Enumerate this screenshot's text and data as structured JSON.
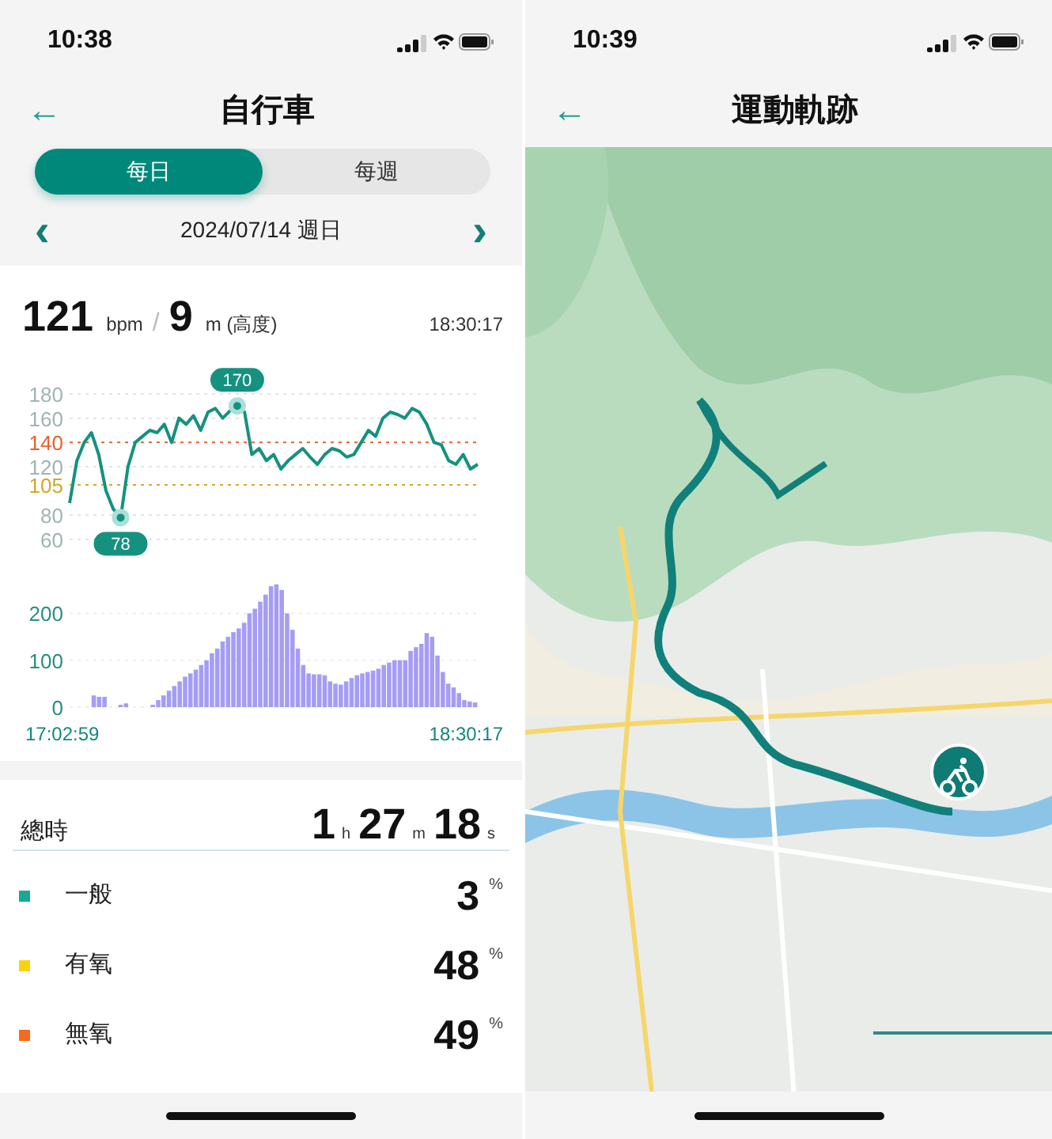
{
  "screens": [
    {
      "status_bar": {
        "time": "10:38"
      },
      "header": {
        "back": "←",
        "title": "自行車"
      },
      "tabs": [
        {
          "label": "每日",
          "selected": true
        },
        {
          "label": "每週",
          "selected": false
        }
      ],
      "date_nav": {
        "prev": "‹",
        "date": "2024/07/14 週日",
        "next": "›"
      },
      "reading": {
        "heart_rate": "121",
        "heart_unit": "bpm",
        "separator": "/",
        "altitude": "9",
        "altitude_unit": "m (高度)",
        "time": "18:30:17"
      },
      "heart_chart": {
        "chart_data": {
          "type": "line",
          "grid": true,
          "ylim": [
            60,
            180
          ],
          "yticks": [
            60,
            80,
            {
              "value": 105,
              "label": "105"
            },
            120,
            {
              "value": 140,
              "label": "140"
            },
            160,
            180
          ],
          "series": [
            {
              "color": "#14927f",
              "values": [
                90,
                125,
                140,
                148,
                130,
                100,
                85,
                78,
                120,
                140,
                145,
                150,
                148,
                155,
                140,
                160,
                155,
                162,
                150,
                165,
                168,
                160,
                166,
                170,
                165,
                130,
                135,
                125,
                130,
                118,
                125,
                130,
                135,
                128,
                122,
                130,
                135,
                133,
                128,
                130,
                140,
                150,
                145,
                160,
                165,
                163,
                160,
                168,
                165,
                155,
                140,
                138,
                125,
                122,
                130,
                118,
                122
              ]
            }
          ],
          "ref_lines": [
            {
              "axis": "y",
              "value": 140,
              "color": "#e8622c"
            },
            {
              "axis": "y",
              "value": 105,
              "color": "#d4a82a"
            }
          ],
          "annotations": [
            {
              "y": 78,
              "text": "78"
            },
            {
              "y": 170,
              "text": "170"
            }
          ]
        }
      },
      "power_chart": {
        "time_range": {
          "start": "17:02:59",
          "end": "18:30:17"
        },
        "chart_data": {
          "type": "bar",
          "grid": true,
          "ylim": [
            0,
            270
          ],
          "yticks": [
            0,
            100,
            200
          ],
          "series": [
            {
              "color": "#a59cf5",
              "values": [
                0,
                0,
                0,
                0,
                25,
                22,
                22,
                0,
                0,
                5,
                8,
                0,
                0,
                0,
                0,
                5,
                15,
                25,
                35,
                45,
                55,
                65,
                72,
                80,
                90,
                100,
                115,
                125,
                140,
                150,
                160,
                168,
                180,
                200,
                210,
                225,
                240,
                258,
                262,
                250,
                200,
                165,
                125,
                90,
                72,
                70,
                70,
                68,
                55,
                50,
                48,
                55,
                62,
                68,
                72,
                75,
                78,
                82,
                90,
                95,
                100,
                100,
                100,
                120,
                128,
                135,
                158,
                150,
                110,
                75,
                50,
                42,
                30,
                15,
                12,
                10
              ]
            }
          ]
        }
      },
      "total": {
        "label": "總時",
        "parts": [
          {
            "value": "1",
            "unit": "h"
          },
          {
            "value": "27",
            "unit": "m"
          },
          {
            "value": "18",
            "unit": "s"
          }
        ]
      },
      "zones": [
        {
          "name": "一般",
          "color": "#1aa896",
          "value": "3",
          "unit": "%"
        },
        {
          "name": "有氧",
          "color": "#fbd20b",
          "value": "48",
          "unit": "%"
        },
        {
          "name": "無氧",
          "color": "#f76a1c",
          "value": "49",
          "unit": "%"
        }
      ]
    },
    {
      "status_bar": {
        "time": "10:39"
      },
      "header": {
        "back": "←",
        "title": "運動軌跡"
      }
    }
  ]
}
